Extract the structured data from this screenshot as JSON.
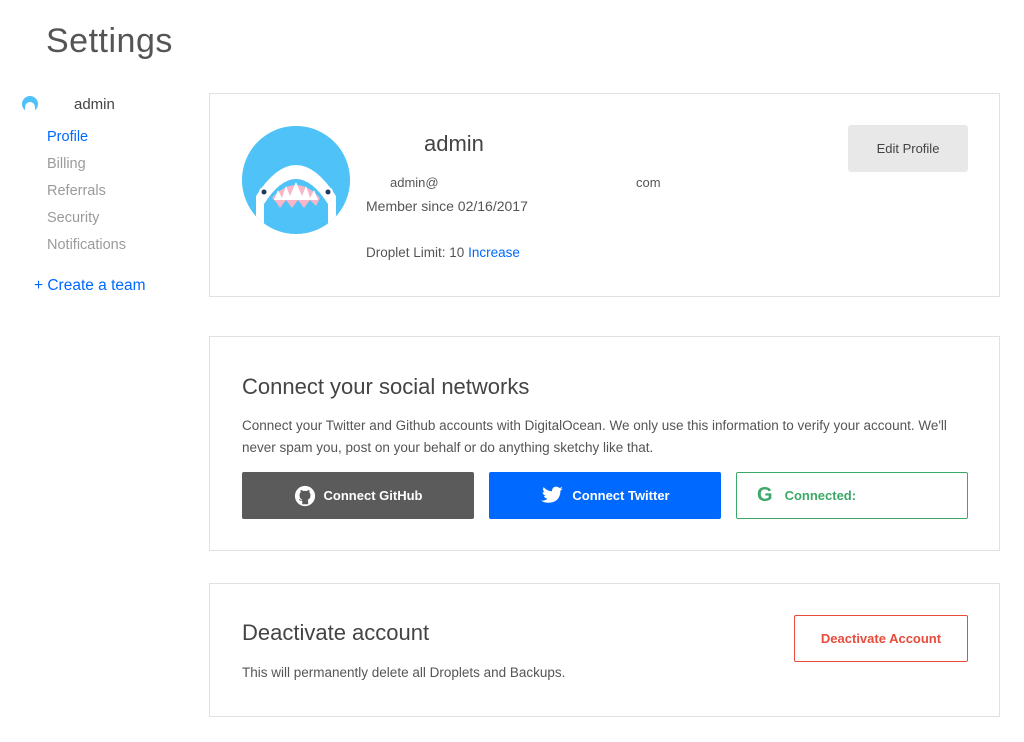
{
  "page": {
    "title": "Settings"
  },
  "sidebar": {
    "user_name": "admin",
    "items": [
      {
        "label": "Profile",
        "active": true
      },
      {
        "label": "Billing",
        "active": false
      },
      {
        "label": "Referrals",
        "active": false
      },
      {
        "label": "Security",
        "active": false
      },
      {
        "label": "Notifications",
        "active": false
      }
    ],
    "create_team": "+ Create a team"
  },
  "profile": {
    "name": "admin",
    "email_start": "admin@",
    "email_end": "com",
    "member_since": "Member since 02/16/2017",
    "droplet_limit": "Droplet Limit: 10",
    "increase_label": "Increase",
    "edit_button": "Edit Profile"
  },
  "social": {
    "title": "Connect your social networks",
    "description": "Connect your Twitter and Github accounts with DigitalOcean. We only use this information to verify your account. We'll never spam you, post on your behalf or do anything sketchy like that.",
    "github_button": "Connect GitHub",
    "twitter_button": "Connect Twitter",
    "google_status": "Connected:"
  },
  "deactivate": {
    "title": "Deactivate account",
    "description": "This will permanently delete all Droplets and Backups.",
    "button": "Deactivate Account"
  },
  "colors": {
    "accent": "#0069ff",
    "danger": "#e74c3c",
    "success": "#3ca96a",
    "github": "#5b5b5b",
    "avatar": "#4fc3f7"
  }
}
